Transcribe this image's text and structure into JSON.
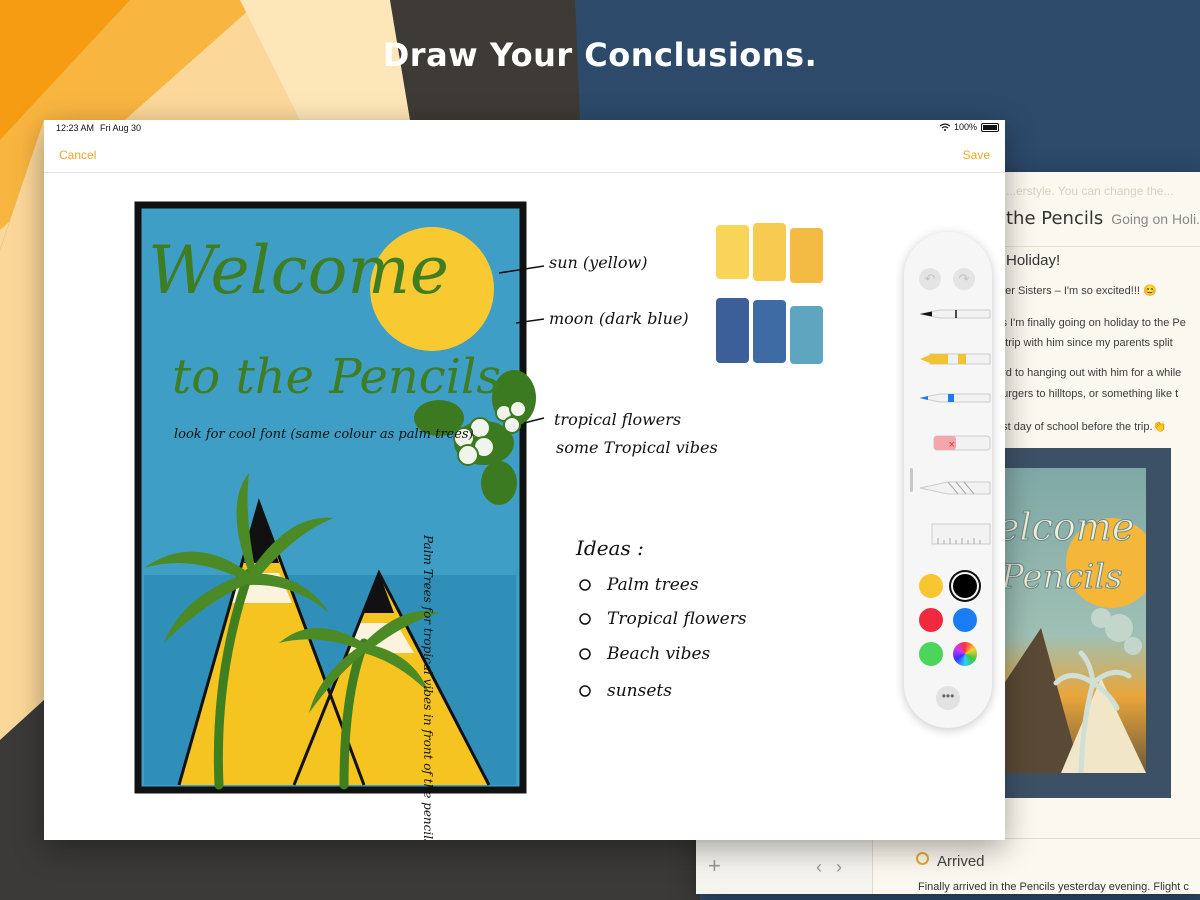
{
  "headline": "Draw Your Conclusions.",
  "status_bar": {
    "time": "12:23 AM",
    "date": "Fri Aug 30",
    "battery": "100%"
  },
  "nav": {
    "cancel": "Cancel",
    "save": "Save"
  },
  "sketch": {
    "title_line1": "Welcome",
    "title_line2": "to the Pencils",
    "note_font": "look for cool font (same colour as palm trees)",
    "note_palm": "Palm Trees for tropical vibes in front of the pencils"
  },
  "annotations": {
    "sun": "sun (yellow)",
    "moon": "moon (dark blue)",
    "flowers_line1": "tropical flowers",
    "flowers_line2": "some Tropical vibes"
  },
  "ideas": {
    "heading": "Ideas :",
    "items": [
      "Palm trees",
      "Tropical flowers",
      "Beach vibes",
      "sunsets"
    ]
  },
  "swatch_colors": {
    "yellow": [
      "#f7cf47",
      "#f5c53c",
      "#f2b230"
    ],
    "blue": [
      "#274e8e",
      "#2a5b9a",
      "#4d9cb8"
    ]
  },
  "tool_palette": {
    "tools": [
      "pen",
      "marker",
      "pencil",
      "eraser",
      "lasso",
      "ruler"
    ],
    "colors": [
      "#f8c630",
      "#000000",
      "#f0293e",
      "#1a7df5",
      "#4cd55b",
      "rainbow"
    ],
    "selected_color": "#000000"
  },
  "journal": {
    "title": "the Pencils",
    "subtitle": "Going on Holi...",
    "faded_header": "...erstyle. You can change the...",
    "heading": "Holiday!",
    "lines": [
      "nter Sisters – I'm so excited!!! 😊",
      "ys I'm finally going on holiday to the Pe",
      "a trip with him since my parents split",
      "ard to hanging out with him for a while",
      "ourgers to hilltops, or something like t",
      "ast day of school before the trip.👏"
    ],
    "entry_title": "Arrived",
    "entry_text": "Finally arrived in the Pencils yesterday evening. Flight c"
  }
}
